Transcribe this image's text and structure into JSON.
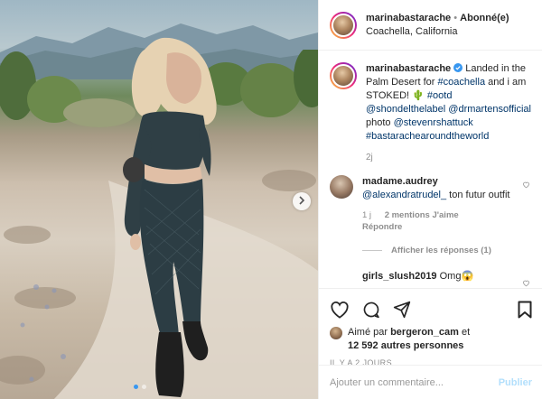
{
  "account": {
    "username": "marinabastarache",
    "separator": "•",
    "follow_status": "Abonné(e)",
    "location": "Coachella, California"
  },
  "caption": {
    "username": "marinabastarache",
    "text_1": " Landed in the Palm Desert for ",
    "tag_coachella": "#coachella",
    "text_2": " and i am STOKED! ",
    "emoji": "🌵",
    "tag_ootd": "#ootd",
    "mention_shondel": "@shondelthelabel",
    "mention_drmartens": "@drmartensofficial",
    "text_3": " photo ",
    "mention_photographer": "@stevenrshattuck",
    "tag_around": "#bastarachearoundtheworld",
    "time": "2j"
  },
  "comments": [
    {
      "username": "madame.audrey",
      "mention": "@alexandratrudel_",
      "text": " ton futur outfit",
      "time": "1 j",
      "likes": "2 mentions J'aime",
      "reply": "Répondre",
      "view_replies": "Afficher les réponses (1)"
    },
    {
      "username": "girls_slush2019",
      "text": " Omg😱"
    }
  ],
  "likes": {
    "prefix": "Aimé par ",
    "user": "bergeron_cam",
    "conj": " et",
    "others": "12 592 autres personnes"
  },
  "posted_time": "IL Y A 2 JOURS",
  "add_comment": {
    "placeholder": "Ajouter un commentaire...",
    "post_label": "Publier"
  },
  "icons": {
    "like": "heart-icon",
    "comment": "comment-icon",
    "share": "share-icon",
    "save": "bookmark-icon",
    "next": "chevron-right-icon"
  },
  "colors": {
    "accent": "#3897f0",
    "link": "#003569",
    "muted": "#8e8e8e",
    "post_disabled": "#b2dffc"
  }
}
